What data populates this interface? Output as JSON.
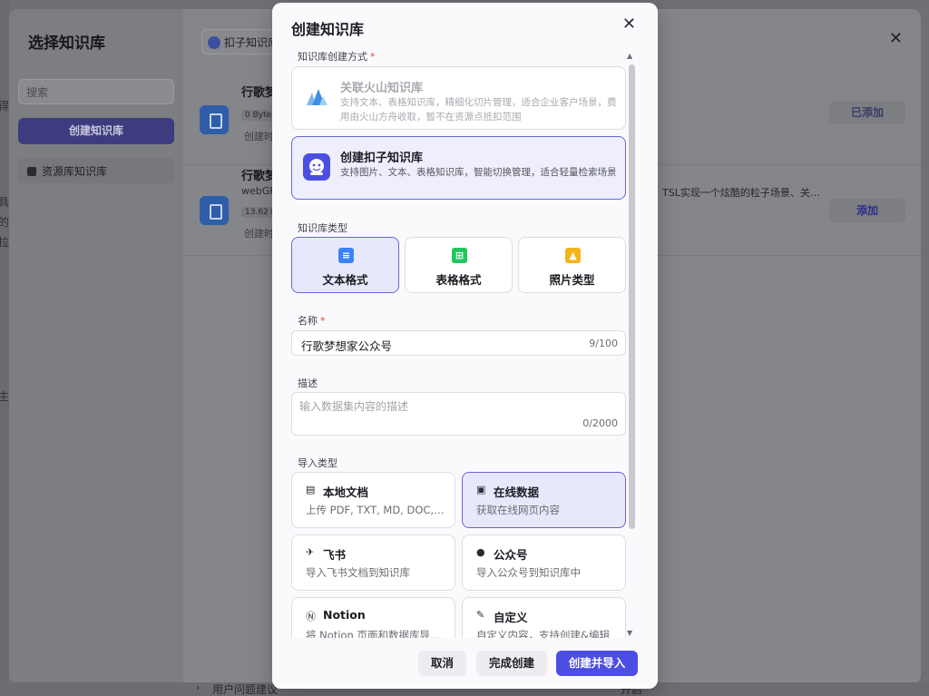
{
  "background": {
    "edge_chars": [
      "得",
      "具",
      "的",
      "拉",
      "主"
    ],
    "outer_modal": {
      "title": "选择知识库",
      "search_placeholder": "搜索",
      "create_button": "创建知识库",
      "sidebar_item": "资源库知识库",
      "tab_chip": "扣子知识库"
    },
    "kb_rows": [
      {
        "title": "行歌梦",
        "sub": "",
        "tag": "0 Byte",
        "meta": "创建时",
        "desc": "",
        "action": "已添加"
      },
      {
        "title": "行歌梦",
        "sub": "webGP",
        "tag": "13.62 K",
        "meta": "创建时",
        "desc": "TSL实现一个炫酷的粒子场景、关…",
        "action": "添加"
      }
    ],
    "bottom_row": {
      "text": "用户问题建议",
      "right": "开启"
    }
  },
  "dialog": {
    "title": "创建知识库",
    "method_label": "知识库创建方式",
    "methods": [
      {
        "title": "关联火山知识库",
        "desc": "支持文本、表格知识库，精细化切片管理，适合企业客户场景，费用由火山方舟收取，暂不在资源点抵扣范围"
      },
      {
        "title": "创建扣子知识库",
        "desc": "支持图片、文本、表格知识库，智能切换管理，适合轻量检索场景"
      }
    ],
    "type_label": "知识库类型",
    "types": [
      {
        "label": "文本格式",
        "color": "#3b82f6"
      },
      {
        "label": "表格格式",
        "color": "#22c55e"
      },
      {
        "label": "照片类型",
        "color": "#f5b31b"
      }
    ],
    "name_label": "名称",
    "name_value": "行歌梦想家公众号",
    "name_count": "9/100",
    "desc_label": "描述",
    "desc_placeholder": "输入数据集内容的描述",
    "desc_count": "0/2000",
    "import_label": "导入类型",
    "imports": [
      {
        "title": "本地文档",
        "desc": "上传 PDF, TXT, MD, DOC, DOCX 格式的本地文件"
      },
      {
        "title": "在线数据",
        "desc": "获取在线网页内容"
      },
      {
        "title": "飞书",
        "desc": "导入飞书文档到知识库"
      },
      {
        "title": "公众号",
        "desc": "导入公众号到知识库中"
      },
      {
        "title": "Notion",
        "desc": "将 Notion 页面和数据库导入到知识库"
      },
      {
        "title": "自定义",
        "desc": "自定义内容，支持创建&编辑"
      }
    ],
    "buttons": {
      "cancel": "取消",
      "finish": "完成创建",
      "create": "创建并导入"
    }
  }
}
